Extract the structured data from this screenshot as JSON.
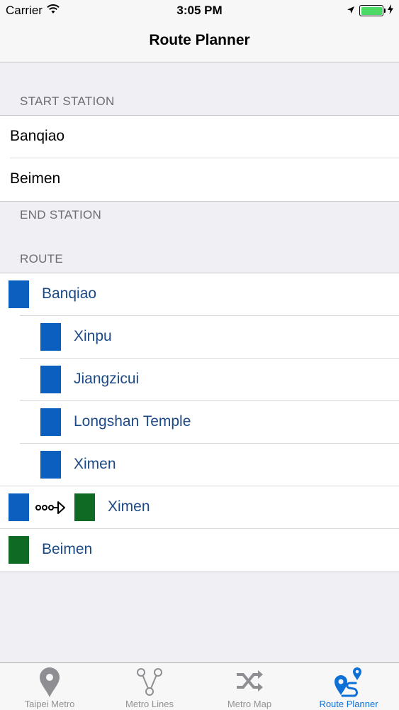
{
  "status_bar": {
    "carrier": "Carrier",
    "time": "3:05 PM"
  },
  "nav": {
    "title": "Route Planner"
  },
  "sections": {
    "start_station": "START STATION",
    "end_station": "END STATION",
    "route": "ROUTE"
  },
  "start_rows": [
    "Banqiao",
    "Beimen"
  ],
  "route": {
    "items": [
      "Banqiao",
      "Xinpu",
      "Jiangzicui",
      "Longshan Temple",
      "Ximen",
      "Ximen",
      "Beimen"
    ]
  },
  "colors": {
    "blue_line": "#0b5fbf",
    "green_line": "#0f6a24",
    "accent": "#0e6fd6"
  },
  "tabs": [
    {
      "label": "Taipei Metro",
      "icon": "map-pin-icon"
    },
    {
      "label": "Metro Lines",
      "icon": "branch-icon"
    },
    {
      "label": "Metro Map",
      "icon": "shuffle-icon"
    },
    {
      "label": "Route Planner",
      "icon": "route-icon"
    }
  ],
  "active_tab": "Route Planner"
}
